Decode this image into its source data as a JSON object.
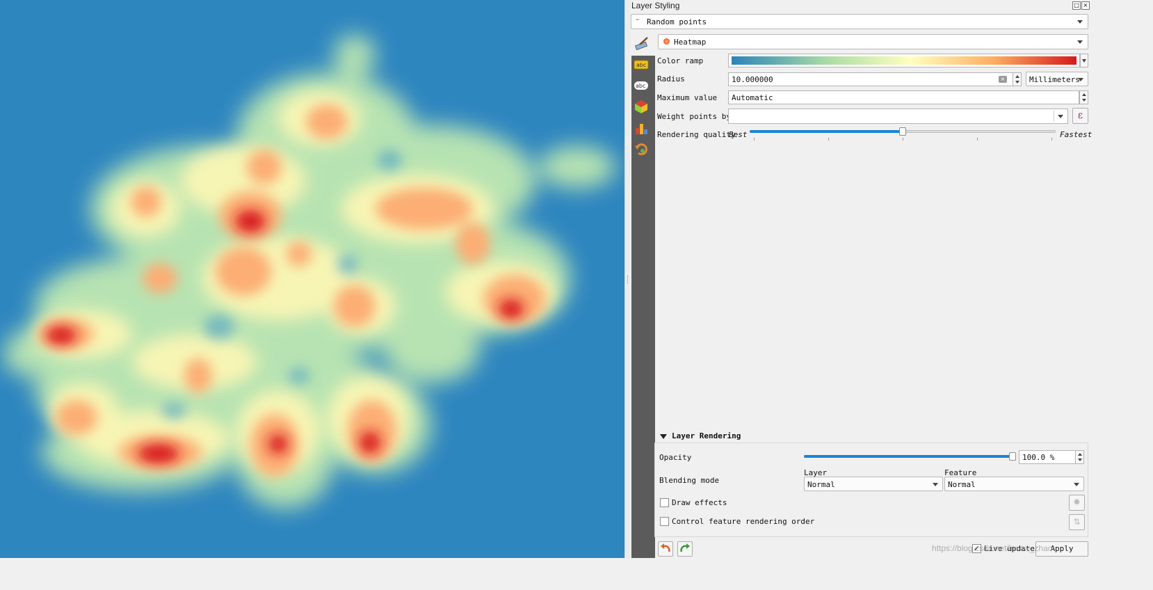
{
  "panel": {
    "title": "Layer Styling",
    "layer_name": "Random points",
    "renderer": "Heatmap"
  },
  "sidebar_icons": [
    "symbology-icon",
    "labels-icon",
    "3d-view-icon",
    "diagram-icon",
    "history-icon"
  ],
  "heatmap": {
    "color_ramp_label": "Color ramp",
    "color_ramp_colors": [
      "#2b83ba",
      "#abdda4",
      "#ffffbf",
      "#fdae61",
      "#d7191c"
    ],
    "radius_label": "Radius",
    "radius_value": "10.000000",
    "radius_unit": "Millimeters",
    "max_value_label": "Maximum value",
    "max_value": "Automatic",
    "weight_label": "Weight points by",
    "weight_value": "",
    "quality_label": "Rendering quality",
    "quality_best": "Best",
    "quality_fastest": "Fastest",
    "quality_level": 0.5
  },
  "layer_rendering": {
    "header": "Layer Rendering",
    "opacity_label": "Opacity",
    "opacity_value": "100.0 %",
    "opacity_fraction": 1.0,
    "blending_label": "Blending mode",
    "layer_col": "Layer",
    "feature_col": "Feature",
    "layer_blend": "Normal",
    "feature_blend": "Normal",
    "draw_effects": "Draw effects",
    "control_order": "Control feature rendering order"
  },
  "footer": {
    "live_update": "Live update",
    "live_update_checked": true,
    "apply": "Apply",
    "watermark": "https://blog.csdn.net/lnxcw_zhao"
  },
  "colors": {
    "map_bg": "#2e86bf",
    "accent": "#1b84d6",
    "sidebar": "#5b5b5b"
  }
}
